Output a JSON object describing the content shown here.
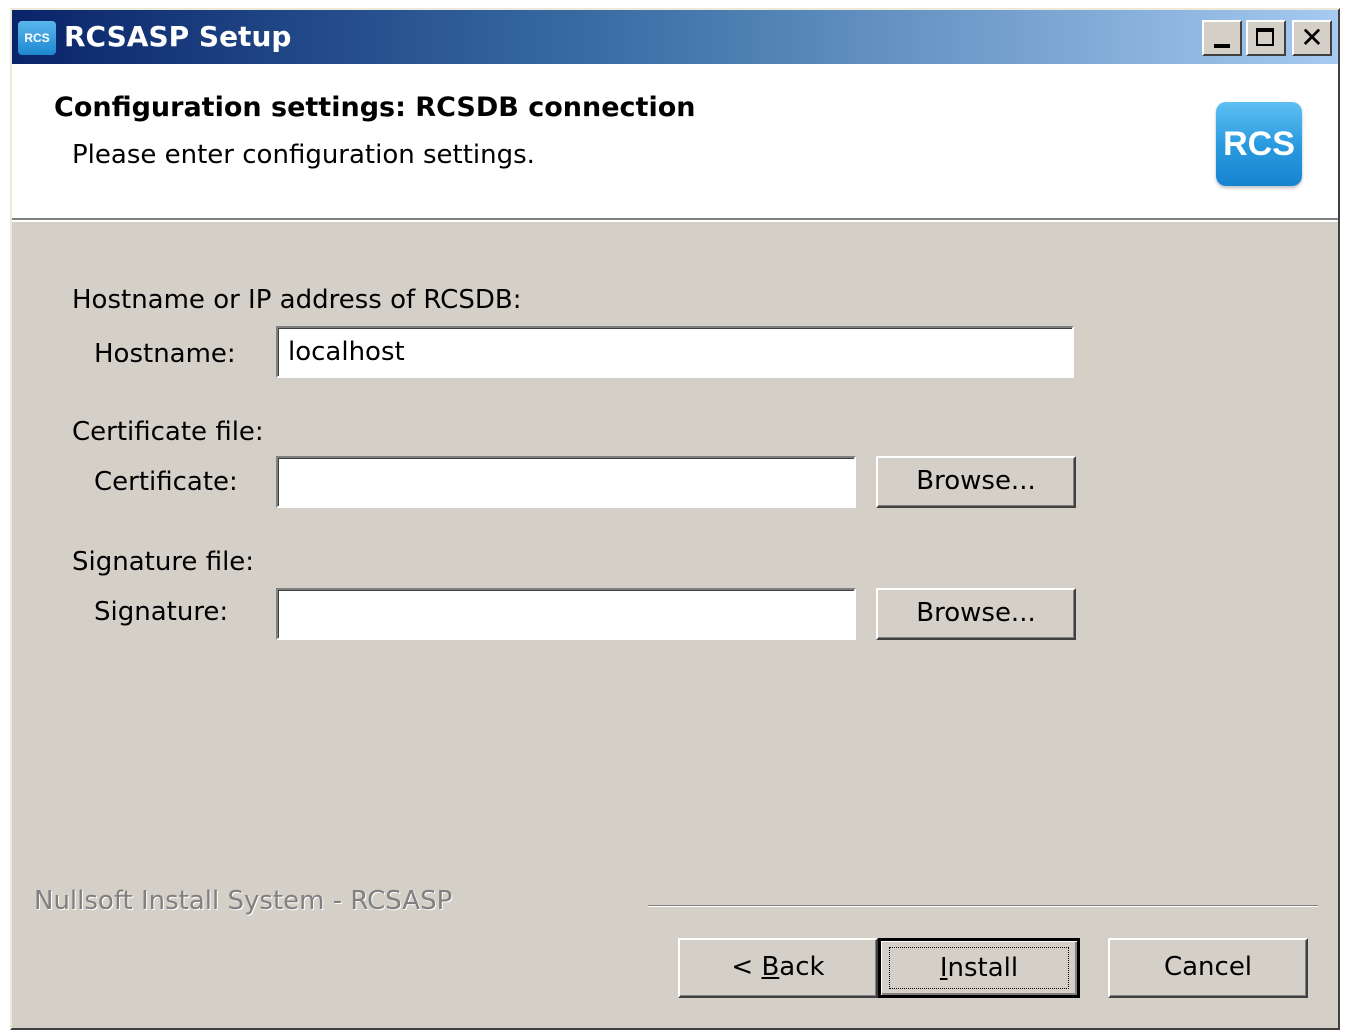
{
  "window": {
    "title": "RCSASP Setup",
    "icon_label": "RCS"
  },
  "header": {
    "title": "Configuration settings: RCSDB connection",
    "subtitle": "Please enter configuration settings.",
    "logo_text": "RCS"
  },
  "form": {
    "host_group_label": "Hostname or IP address of RCSDB:",
    "hostname_label": "Hostname:",
    "hostname_value": "localhost",
    "cert_group_label": "Certificate file:",
    "cert_label": "Certificate:",
    "cert_value": "",
    "sig_group_label": "Signature file:",
    "sig_label": "Signature:",
    "sig_value": "",
    "browse_label": "Browse..."
  },
  "footer": {
    "branding": "Nullsoft Install System - RCSASP",
    "back_prefix": "< ",
    "back_mnemonic": "B",
    "back_rest": "ack",
    "install_mnemonic": "I",
    "install_rest": "nstall",
    "cancel_label": "Cancel"
  },
  "icons": {
    "minimize": "minimize-icon",
    "maximize": "maximize-icon",
    "close": "close-icon"
  }
}
